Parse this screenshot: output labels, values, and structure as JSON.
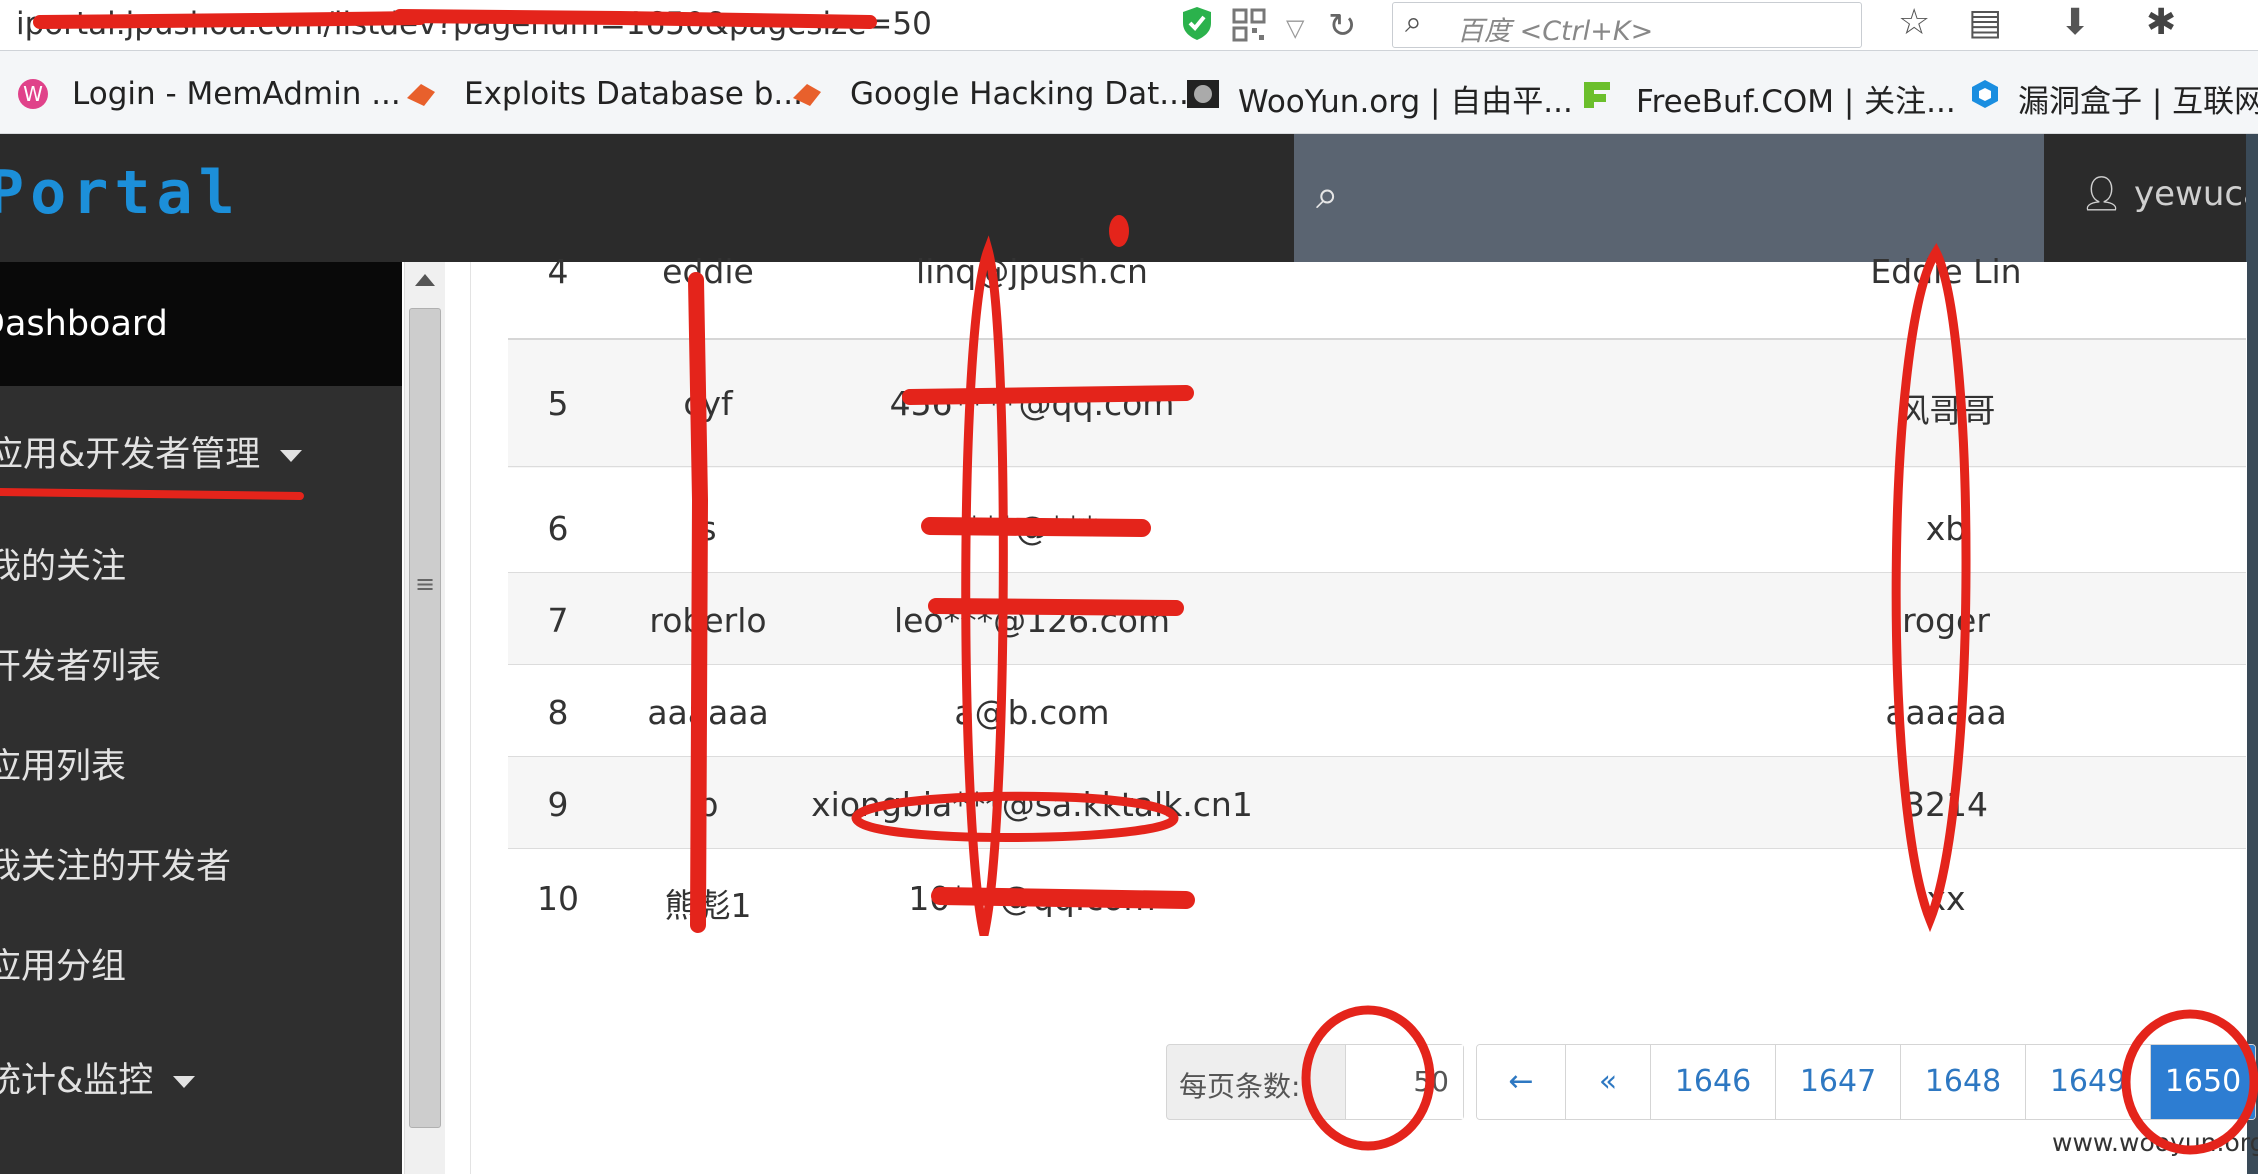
{
  "browser": {
    "url": "iportal.jpushoa.com/listdev?pagenum=1650&pagesize=50",
    "search_placeholder": "百度 <Ctrl+K>",
    "icons": [
      "shield-icon",
      "qr-code-icon",
      "dropdown-icon",
      "reload-icon",
      "star-icon",
      "clipboard-icon",
      "download-icon",
      "bug-icon"
    ],
    "bookmarks": [
      {
        "label": "Login - MemAdmin ...",
        "icon": "memadmin-icon"
      },
      {
        "label": "Exploits Database b...",
        "icon": "exploitdb-icon"
      },
      {
        "label": "Google Hacking Dat...",
        "icon": "exploitdb-icon"
      },
      {
        "label": "WooYun.org | 自由平...",
        "icon": "wooyun-icon"
      },
      {
        "label": "FreeBuf.COM | 关注...",
        "icon": "freebuf-icon"
      },
      {
        "label": "漏洞盒子 | 互联网安",
        "icon": "vulbox-icon"
      }
    ]
  },
  "header": {
    "brand": "Portal",
    "user": "yewucai",
    "brand_color": "#1c8fd9"
  },
  "sidebar": {
    "dashboard": "Dashboard",
    "items": [
      {
        "label": "应用&开发者管理",
        "has_caret": true
      },
      {
        "label": "我的关注"
      },
      {
        "label": "开发者列表"
      },
      {
        "label": "应用列表"
      },
      {
        "label": "我关注的开发者"
      },
      {
        "label": "应用分组"
      },
      {
        "label": "统计&监控",
        "has_caret": true
      }
    ]
  },
  "table": {
    "rows": [
      {
        "no": "4",
        "username": "eddie",
        "email": "linq@jpush.cn",
        "name": "Eddie Lin"
      },
      {
        "no": "5",
        "username": "cyf",
        "email": "456****@qq.com",
        "name": "风哥哥"
      },
      {
        "no": "6",
        "username": "s",
        "email": "***@***",
        "name": "xb"
      },
      {
        "no": "7",
        "username": "roberlo",
        "email": "leo***@126.com",
        "name": "roger"
      },
      {
        "no": "8",
        "username": "aaaaaa",
        "email": "a@b.com",
        "name": "aaaaaa"
      },
      {
        "no": "9",
        "username": "b",
        "email": "xiongbia***@sa.kktalk.cn1",
        "name": "3214"
      },
      {
        "no": "10",
        "username": "熊彪1",
        "email": "10***@qq.com",
        "name": "xx"
      }
    ]
  },
  "pagination": {
    "per_page_label": "每页条数:",
    "per_page_value": "50",
    "prev": "←",
    "first": "«",
    "pages": [
      "1646",
      "1647",
      "1648",
      "1649",
      "1650"
    ],
    "current": "1650",
    "active_color": "#2d7dd2"
  },
  "watermark": "www.wooyun.org"
}
